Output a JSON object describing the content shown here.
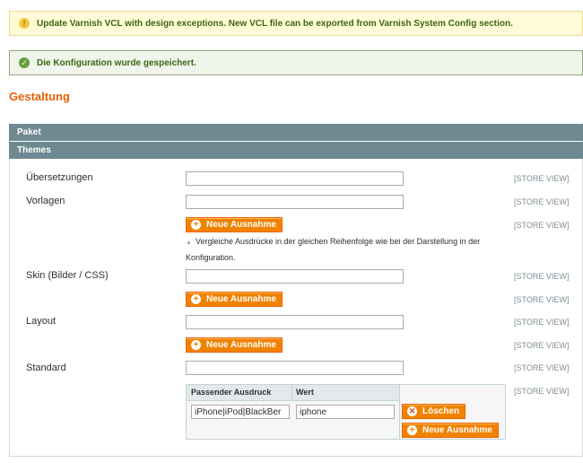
{
  "messages": {
    "notice": "Update Varnish VCL with design exceptions. New VCL file can be exported from Varnish System Config section.",
    "success": "Die Konfiguration wurde gespeichert."
  },
  "page": {
    "title": "Gestaltung"
  },
  "sections": {
    "paket": "Paket",
    "themes": "Themes"
  },
  "fields": [
    {
      "label": "Übersetzungen",
      "value": "",
      "scope": "[STORE VIEW]"
    },
    {
      "label": "Vorlagen",
      "value": "",
      "scope": "[STORE VIEW]"
    },
    {
      "label": "Skin (Bilder / CSS)",
      "value": "",
      "scope": "[STORE VIEW]"
    },
    {
      "label": "Layout",
      "value": "",
      "scope": "[STORE VIEW]"
    },
    {
      "label": "Standard",
      "value": "",
      "scope": "[STORE VIEW]"
    }
  ],
  "exceptions": [
    {
      "button": "Neue Ausnahme",
      "scope": "[STORE VIEW]"
    },
    {
      "button": "Neue Ausnahme",
      "scope": "[STORE VIEW]"
    },
    {
      "button": "Neue Ausnahme",
      "scope": "[STORE VIEW]"
    }
  ],
  "hint": "Vergleiche Ausdrücke in der gleichen Reihenfolge wie bei der Darstellung in der Konfiguration.",
  "grid": {
    "col_expression": "Passender Ausdruck",
    "col_value": "Wert",
    "rows": [
      {
        "expression": "iPhone|iPod|BlackBer",
        "value": "iphone"
      }
    ],
    "delete_label": "Löschen",
    "add_label": "Neue Ausnahme",
    "scope": "[STORE VIEW]"
  },
  "icons": {
    "notice": "lightbulb-icon",
    "success": "check-circle-icon",
    "add": "plus-circle-icon",
    "delete": "x-circle-icon"
  },
  "colors": {
    "accent_orange": "#eb5e00",
    "button_orange": "#f18200",
    "section_header": "#6f8992",
    "notice_bg": "#fffbd6",
    "success_bg": "#eff5ea",
    "scope_text": "#7f8e95"
  }
}
